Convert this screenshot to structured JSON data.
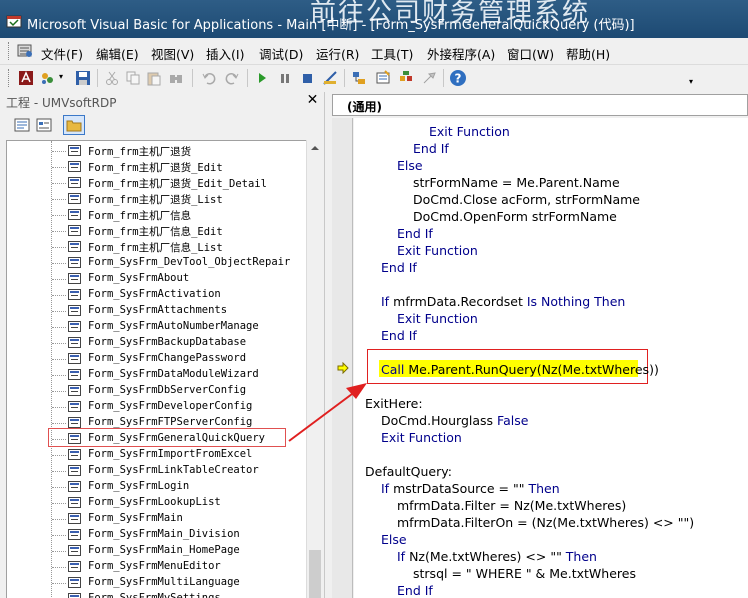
{
  "window": {
    "title": "Microsoft Visual Basic for Applications - Main [中断] - [Form_SysFrmGeneralQuickQuery (代码)]",
    "background_text": "前往公司财务管理系统"
  },
  "menu": {
    "items": [
      "文件(F)",
      "编辑(E)",
      "视图(V)",
      "插入(I)",
      "调试(D)",
      "运行(R)",
      "工具(T)",
      "外接程序(A)",
      "窗口(W)",
      "帮助(H)"
    ]
  },
  "toolbar": {
    "icons": [
      "access-view-icon",
      "insert-module-icon",
      "save-icon",
      "cut-icon",
      "copy-icon",
      "paste-icon",
      "find-icon",
      "undo-icon",
      "redo-icon",
      "run-icon",
      "break-icon",
      "reset-icon",
      "design-mode-icon",
      "project-explorer-icon",
      "properties-icon",
      "object-browser-icon",
      "toolbox-icon",
      "help-icon"
    ]
  },
  "project": {
    "title": "工程 - UMVsoftRDP",
    "close": "✕",
    "items": [
      "Form_frm主机厂退货",
      "Form_frm主机厂退货_Edit",
      "Form_frm主机厂退货_Edit_Detail",
      "Form_frm主机厂退货_List",
      "Form_frm主机厂信息",
      "Form_frm主机厂信息_Edit",
      "Form_frm主机厂信息_List",
      "Form_SysFrm_DevTool_ObjectRepair",
      "Form_SysFrmAbout",
      "Form_SysFrmActivation",
      "Form_SysFrmAttachments",
      "Form_SysFrmAutoNumberManage",
      "Form_SysFrmBackupDatabase",
      "Form_SysFrmChangePassword",
      "Form_SysFrmDataModuleWizard",
      "Form_SysFrmDbServerConfig",
      "Form_SysFrmDeveloperConfig",
      "Form_SysFrmFTPServerConfig",
      "Form_SysFrmGeneralQuickQuery",
      "Form_SysFrmImportFromExcel",
      "Form_SysFrmLinkTableCreator",
      "Form_SysFrmLogin",
      "Form_SysFrmLookupList",
      "Form_SysFrmMain",
      "Form_SysFrmMain_Division",
      "Form_SysFrmMain_HomePage",
      "Form_SysFrmMenuEditor",
      "Form_SysFrmMultiLanguage",
      "Form_SysFrmMySettings"
    ],
    "highlighted_item": "Form_SysFrmGeneralQuickQuery"
  },
  "code": {
    "procedure": "(通用)",
    "lines": [
      "Exit Function",
      "End If",
      "Else",
      "strFormName = Me.Parent.Name",
      "DoCmd.Close acForm, strFormName",
      "DoCmd.OpenForm strFormName",
      "End If",
      "Exit Function",
      "End If",
      "If mfrmData.Recordset Is Nothing Then",
      "Exit Function",
      "End If",
      "Call Me.Parent.RunQuery(Nz(Me.txtWheres))",
      "ExitHere:",
      "DoCmd.Hourglass False",
      "Exit Function",
      "DefaultQuery:",
      "If mstrDataSource = \"\" Then",
      "mfrmData.Filter = Nz(Me.txtWheres)",
      "mfrmData.FilterOn = (Nz(Me.txtWheres) <> \"\")",
      "Else",
      "If Nz(Me.txtWheres) <> \"\" Then",
      "strsql = \" WHERE \" & Me.txtWheres",
      "End If"
    ],
    "current_line": "Call Me.Parent.RunQuery(Nz(Me.txtWheres))"
  },
  "colors": {
    "keyword": "#00008b",
    "current_line_highlight": "#ffff00",
    "annotation_red": "#e02020",
    "titlebar": "#1d4a73"
  }
}
